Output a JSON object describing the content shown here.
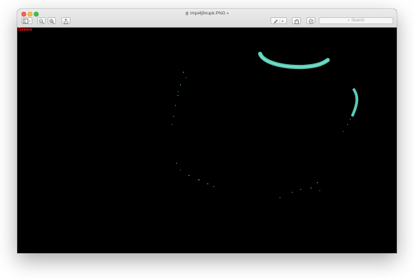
{
  "window": {
    "title": "tmpi4j9nupk.PNG"
  },
  "toolbar": {
    "search_placeholder": "Search"
  },
  "image": {
    "channel_label": "Green",
    "label_color": "#ff1a1a",
    "stroke_color": "#5fd6c0"
  },
  "colors": {
    "close": "#fc605c",
    "minimize": "#fdbc40",
    "maximize": "#34c84a"
  }
}
